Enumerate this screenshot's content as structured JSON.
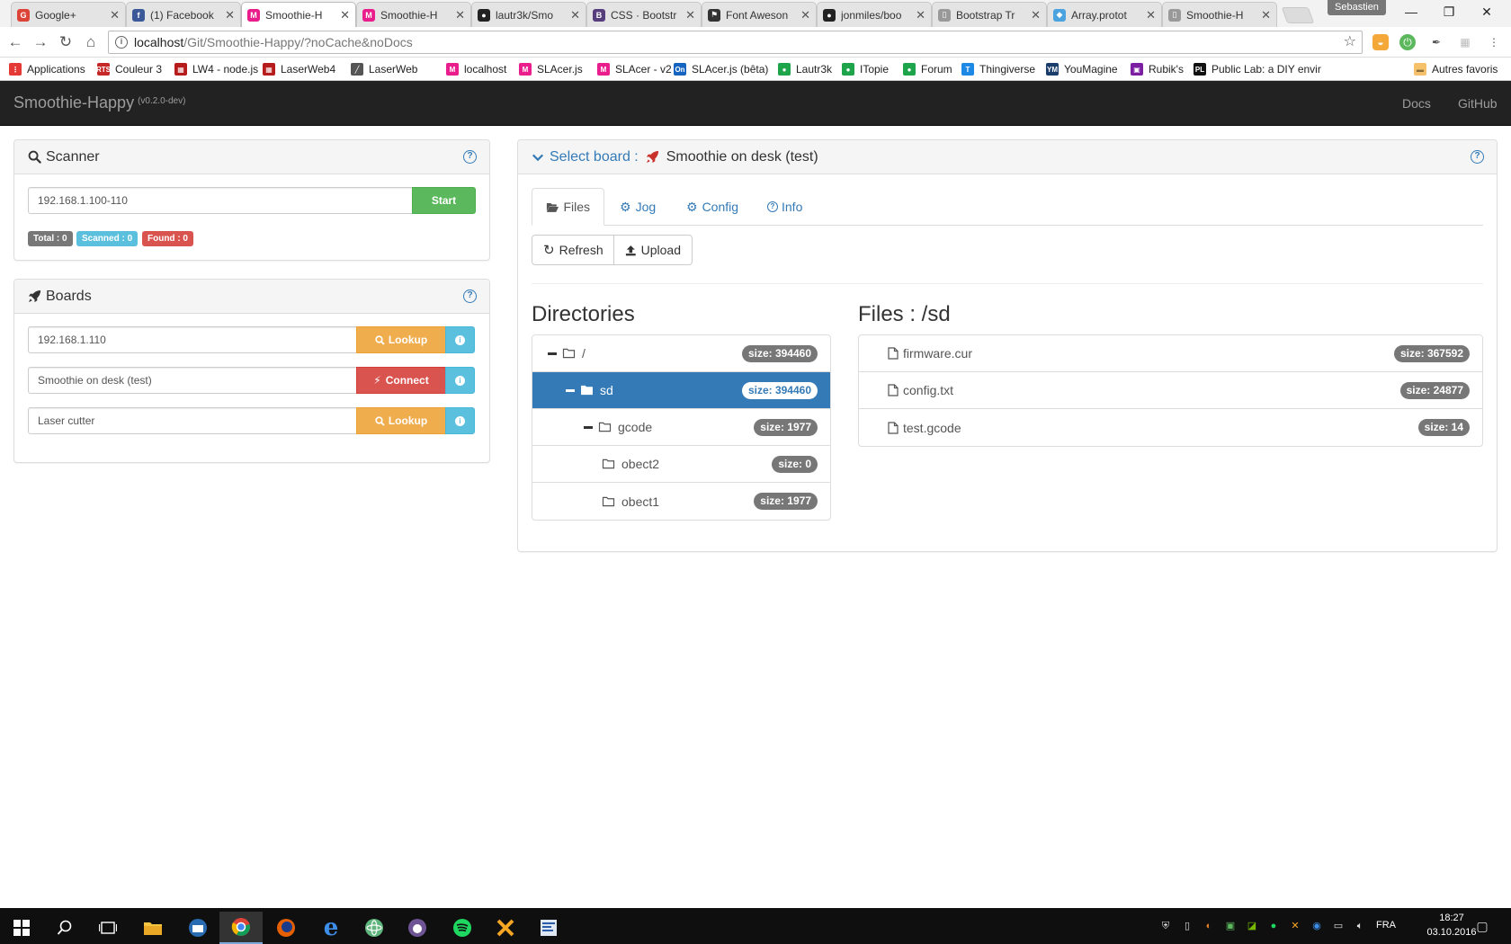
{
  "browser": {
    "tabs": [
      {
        "label": "Google+",
        "color": "#db4437",
        "glyph": "G"
      },
      {
        "label": "(1) Facebook",
        "color": "#3b5998",
        "glyph": "f"
      },
      {
        "label": "Smoothie-H",
        "color": "#e91e8c",
        "glyph": "M"
      },
      {
        "label": "Smoothie-H",
        "color": "#e91e8c",
        "glyph": "M"
      },
      {
        "label": "lautr3k/Smo",
        "color": "#222222",
        "glyph": "●"
      },
      {
        "label": "CSS · Bootstr",
        "color": "#563d7c",
        "glyph": "B"
      },
      {
        "label": "Font Aweson",
        "color": "#333333",
        "glyph": "⚑"
      },
      {
        "label": "jonmiles/boo",
        "color": "#222222",
        "glyph": "●"
      },
      {
        "label": "Bootstrap Tr",
        "color": "#999999",
        "glyph": "▯"
      },
      {
        "label": "Array.protot",
        "color": "#4aa3df",
        "glyph": "◆"
      },
      {
        "label": "Smoothie-H",
        "color": "#999999",
        "glyph": "▯"
      }
    ],
    "profile": "Sebastien",
    "url_host": "localhost",
    "url_path": "/Git/Smoothie-Happy/?noCache&noDocs",
    "bookmarks": [
      {
        "label": "Applications",
        "color": "#e53935",
        "glyph": "⋮"
      },
      {
        "label": "Couleur 3",
        "color": "#c62828",
        "glyph": "RTS"
      },
      {
        "label": "LW4 - node.js",
        "color": "#b71c1c",
        "glyph": "▦"
      },
      {
        "label": "LaserWeb4",
        "color": "#b71c1c",
        "glyph": "▦"
      },
      {
        "label": "LaserWeb",
        "color": "#555555",
        "glyph": "╱"
      },
      {
        "label": "localhost",
        "color": "#e91e8c",
        "glyph": "M"
      },
      {
        "label": "SLAcer.js",
        "color": "#e91e8c",
        "glyph": "M"
      },
      {
        "label": "SLAcer - v2",
        "color": "#e91e8c",
        "glyph": "M"
      },
      {
        "label": "SLAcer.js (bêta)",
        "color": "#1565c0",
        "glyph": "On"
      },
      {
        "label": "Lautr3k",
        "color": "#1ea44a",
        "glyph": "●"
      },
      {
        "label": "ITopie",
        "color": "#1ea44a",
        "glyph": "●"
      },
      {
        "label": "Forum",
        "color": "#1ea44a",
        "glyph": "●"
      },
      {
        "label": "Thingiverse",
        "color": "#1e88e5",
        "glyph": "T"
      },
      {
        "label": "YouMagine",
        "color": "#1a3d6b",
        "glyph": "YM"
      },
      {
        "label": "Rubik's",
        "color": "#7b1fa2",
        "glyph": "▣"
      },
      {
        "label": "Public Lab: a DIY envir",
        "color": "#111111",
        "glyph": "PL"
      }
    ],
    "other_bookmarks": "Autres favoris"
  },
  "app": {
    "brand": "Smoothie-Happy",
    "version": "(v0.2.0-dev)",
    "nav": [
      "Docs",
      "GitHub"
    ]
  },
  "scanner": {
    "title": "Scanner",
    "input_value": "192.168.1.100-110",
    "start_label": "Start",
    "total": "Total : 0",
    "scanned": "Scanned : 0",
    "found": "Found : 0"
  },
  "boards": {
    "title": "Boards",
    "rows": [
      {
        "value": "192.168.1.110",
        "action": "Lookup",
        "type": "warning"
      },
      {
        "value": "Smoothie on desk (test)",
        "action": "Connect",
        "type": "danger"
      },
      {
        "value": "Laser cutter",
        "action": "Lookup",
        "type": "warning"
      }
    ]
  },
  "board_panel": {
    "select_label": "Select board :",
    "board_name": "Smoothie on desk (test)",
    "tabs": [
      "Files",
      "Jog",
      "Config",
      "Info"
    ],
    "refresh_label": "Refresh",
    "upload_label": "Upload",
    "directories_title": "Directories",
    "files_title": "Files : /sd",
    "directories": [
      {
        "name": "/",
        "size": "size: 394460",
        "depth": 0,
        "expanded": true,
        "active": false
      },
      {
        "name": "sd",
        "size": "size: 394460",
        "depth": 1,
        "expanded": true,
        "active": true
      },
      {
        "name": "gcode",
        "size": "size: 1977",
        "depth": 2,
        "expanded": true,
        "active": false
      },
      {
        "name": "obect2",
        "size": "size: 0",
        "depth": 3,
        "expanded": false,
        "active": false
      },
      {
        "name": "obect1",
        "size": "size: 1977",
        "depth": 3,
        "expanded": false,
        "active": false
      }
    ],
    "files": [
      {
        "name": "firmware.cur",
        "size": "size: 367592"
      },
      {
        "name": "config.txt",
        "size": "size: 24877"
      },
      {
        "name": "test.gcode",
        "size": "size: 14"
      }
    ]
  },
  "taskbar": {
    "lang": "FRA",
    "time": "18:27",
    "date": "03.10.2016"
  },
  "colors": {
    "primary": "#337ab7",
    "success": "#5cb85c",
    "warning": "#f0ad4e",
    "danger": "#d9534f",
    "info": "#5bc0de",
    "default_label": "#777777",
    "navbar": "#222222"
  }
}
